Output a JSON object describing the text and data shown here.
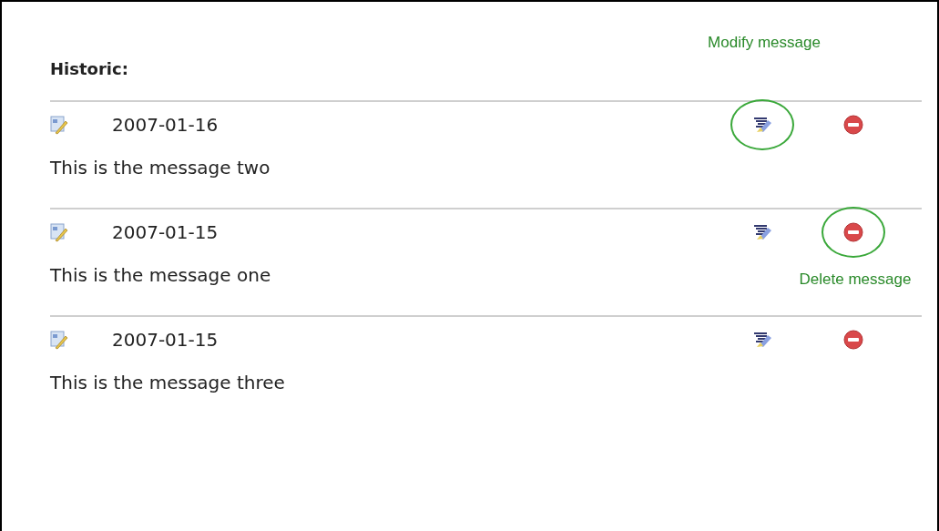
{
  "heading": "Historic:",
  "messages": [
    {
      "date": "2007-01-16",
      "text": "This is the message two",
      "edit_circled": true,
      "delete_circled": false
    },
    {
      "date": "2007-01-15",
      "text": "This is the message one",
      "edit_circled": false,
      "delete_circled": true
    },
    {
      "date": "2007-01-15",
      "text": "This is the message three",
      "edit_circled": false,
      "delete_circled": false
    }
  ],
  "annotations": [
    {
      "kind": "modify",
      "text": "Modify message"
    },
    {
      "kind": "delete",
      "text": "Delete message"
    }
  ]
}
